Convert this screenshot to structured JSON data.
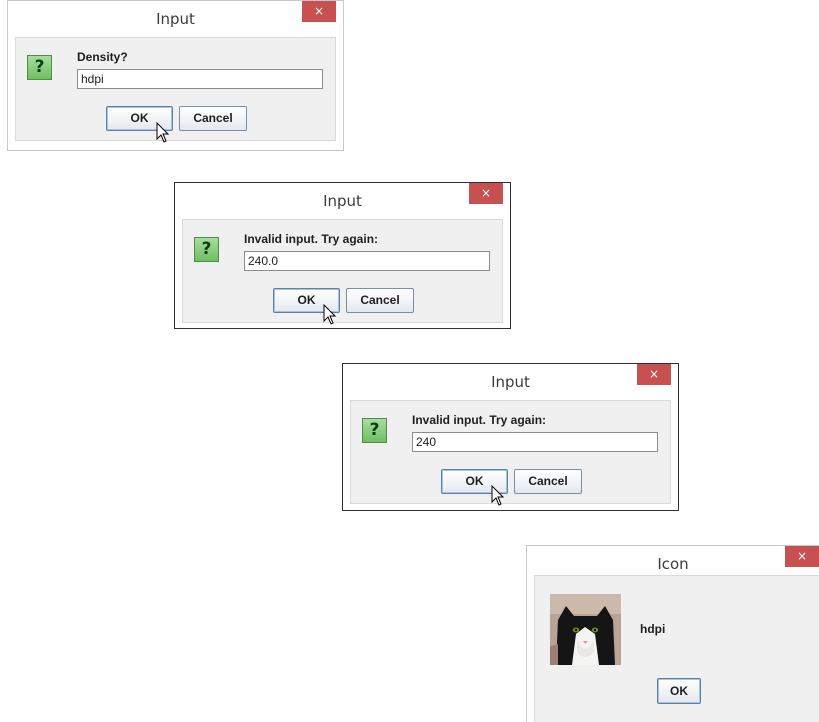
{
  "dialogs": [
    {
      "title": "Input",
      "close_glyph": "×",
      "prompt": "Density?",
      "input_value": "hdpi",
      "ok_label": "OK",
      "cancel_label": "Cancel",
      "icon": "question-icon"
    },
    {
      "title": "Input",
      "close_glyph": "×",
      "prompt": "Invalid input. Try again:",
      "input_value": "240.0",
      "ok_label": "OK",
      "cancel_label": "Cancel",
      "icon": "question-icon"
    },
    {
      "title": "Input",
      "close_glyph": "×",
      "prompt": "Invalid input. Try again:",
      "input_value": "240",
      "ok_label": "OK",
      "cancel_label": "Cancel",
      "icon": "question-icon"
    }
  ],
  "icon_dialog": {
    "title": "Icon",
    "close_glyph": "×",
    "message": "hdpi",
    "ok_label": "OK",
    "image": "cat-photo"
  },
  "icons": {
    "question_glyph": "?"
  },
  "colors": {
    "close_button": "#c75050",
    "question_icon": "#6fbf62",
    "content_bg": "#f0f0f0"
  }
}
